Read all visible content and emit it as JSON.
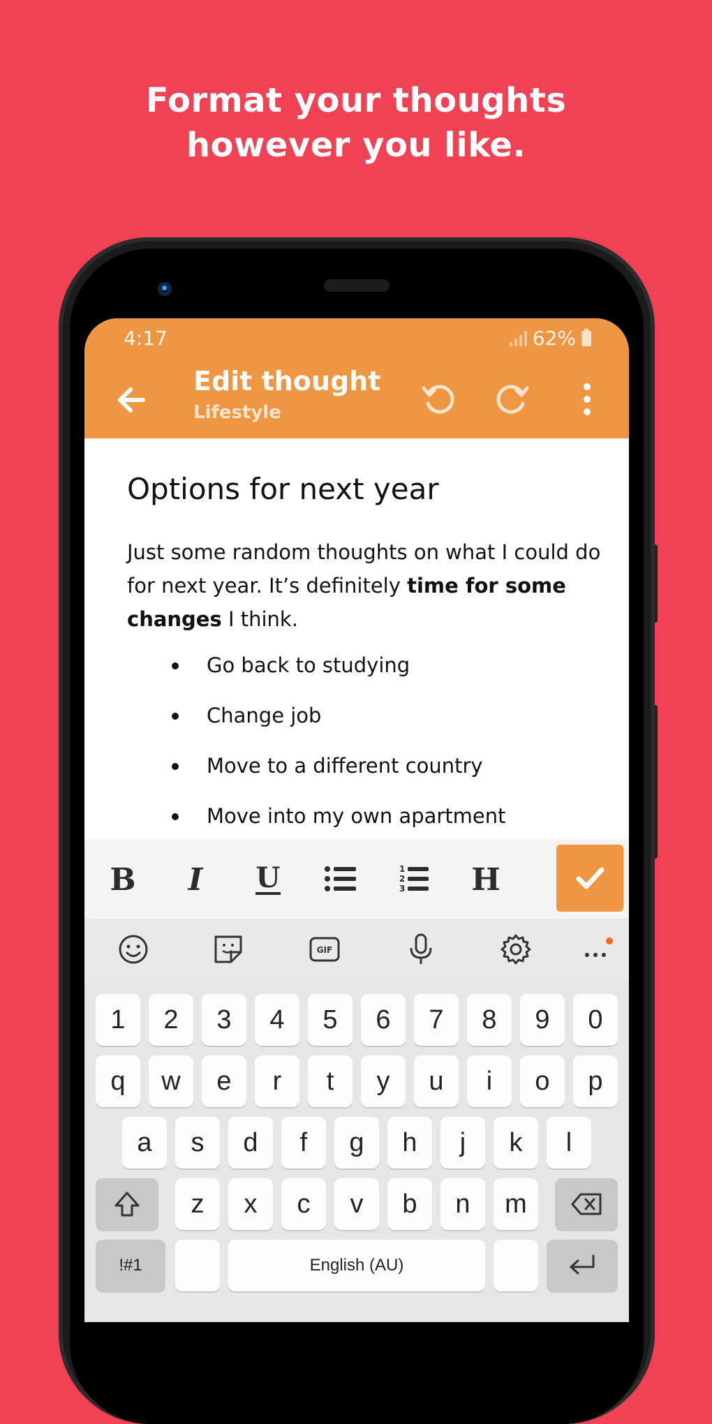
{
  "headline": {
    "line1": "Format your thoughts",
    "line2": "however you like."
  },
  "status": {
    "time": "4:17",
    "battery": "62%"
  },
  "appbar": {
    "title": "Edit thought",
    "subtitle": "Lifestyle"
  },
  "note": {
    "title": "Options for next year",
    "body_part1": "Just some random thoughts on what I could do for next year. It’s definitely ",
    "body_bold": "time for some changes",
    "body_part2": " I think.",
    "bullets": [
      "Go back to studying",
      "Change job",
      "Move to a different country",
      "Move into my own apartment"
    ]
  },
  "toolbar": {
    "icons": [
      "bold-icon",
      "italic-icon",
      "underline-icon",
      "bullet-list-icon",
      "numbered-list-icon",
      "heading-icon",
      "check-icon"
    ]
  },
  "keyboard": {
    "top_icons": [
      "emoji-icon",
      "sticker-icon",
      "gif-icon",
      "microphone-icon",
      "settings-icon",
      "more-icon"
    ],
    "number_row": [
      "1",
      "2",
      "3",
      "4",
      "5",
      "6",
      "7",
      "8",
      "9",
      "0"
    ],
    "row1": [
      "q",
      "w",
      "e",
      "r",
      "t",
      "y",
      "u",
      "i",
      "o",
      "p"
    ],
    "row2": [
      "a",
      "s",
      "d",
      "f",
      "g",
      "h",
      "j",
      "k",
      "l"
    ],
    "row3": [
      "z",
      "x",
      "c",
      "v",
      "b",
      "n",
      "m"
    ],
    "symbols_key": "!#1",
    "space_label": "English (AU)"
  },
  "colors": {
    "background": "#f04155",
    "accent": "#ef9642"
  }
}
